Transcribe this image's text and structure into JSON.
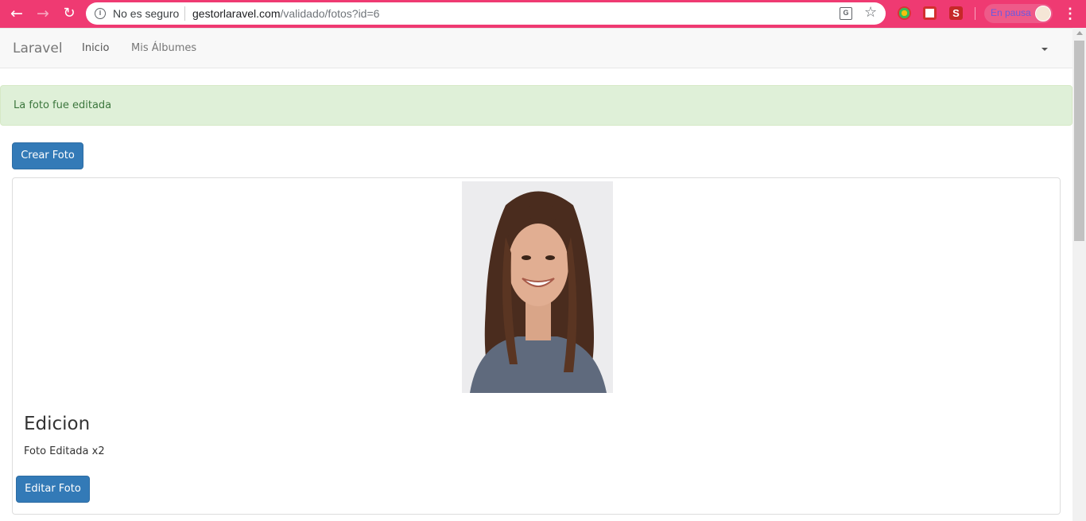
{
  "browser": {
    "security_label": "No es seguro",
    "url_host": "gestorlaravel.com",
    "url_path": "/validado/fotos?id=6",
    "profile_label": "En pausa",
    "accent_color": "#ef3a72"
  },
  "navbar": {
    "brand": "Laravel",
    "links": [
      "Inicio",
      "Mis Álbumes"
    ]
  },
  "alert": {
    "message": "La foto fue editada",
    "type": "success"
  },
  "actions": {
    "create_label": "Crear Foto"
  },
  "photo": {
    "title": "Edicion",
    "description": "Foto Editada x2",
    "edit_label": "Editar Foto"
  }
}
